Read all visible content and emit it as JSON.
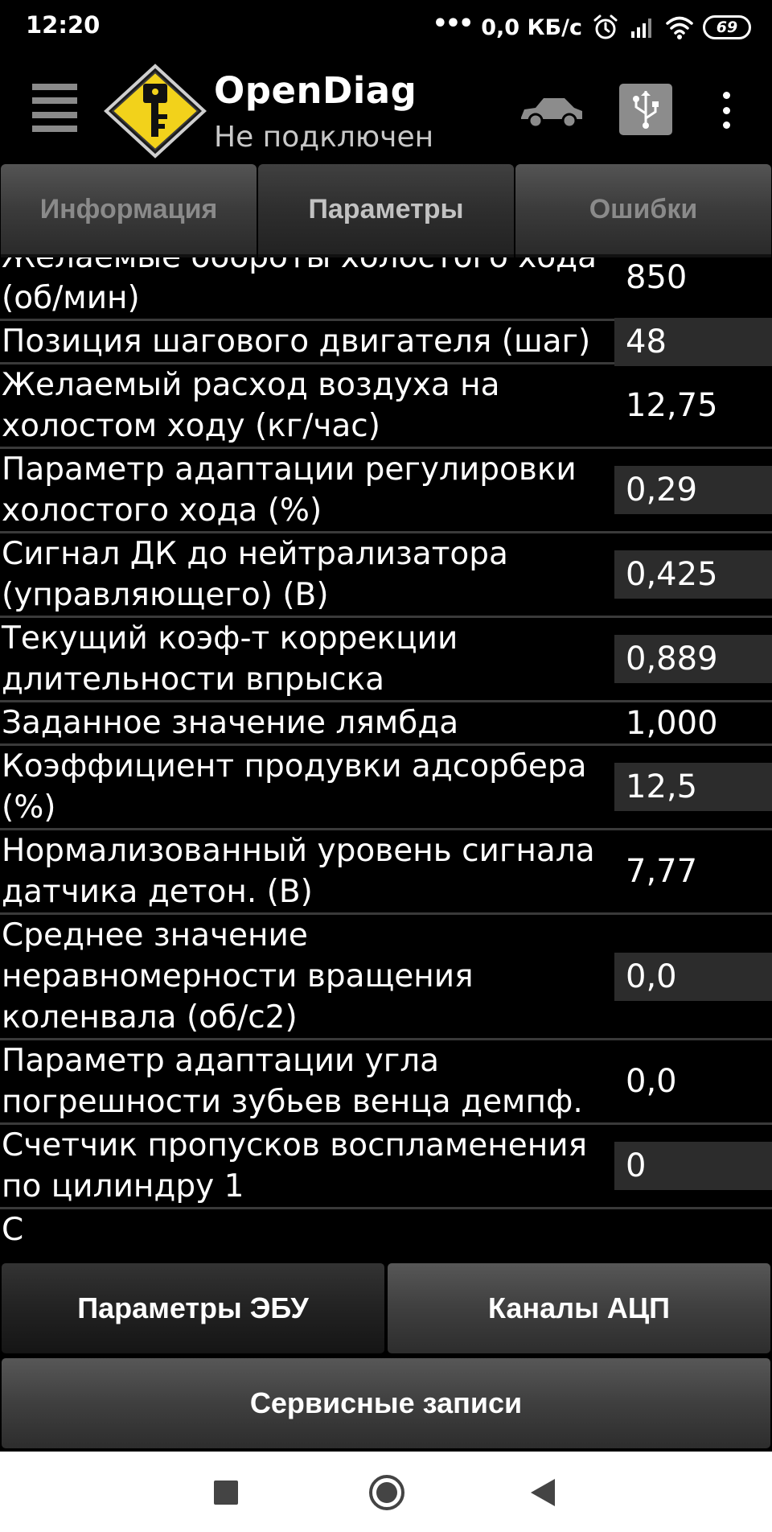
{
  "status_bar": {
    "time": "12:20",
    "dots": "•••",
    "speed": "0,0 КБ/с",
    "battery": "69"
  },
  "toolbar": {
    "title": "OpenDiag",
    "subtitle": "Не подключен",
    "icons": [
      "menu-icon",
      "key-logo-icon",
      "car-icon",
      "usb-icon",
      "more-vert-icon"
    ]
  },
  "tabs": [
    {
      "label": "Информация",
      "active": false
    },
    {
      "label": "Параметры",
      "active": true
    },
    {
      "label": "Ошибки",
      "active": false
    }
  ],
  "parameters": [
    {
      "name": "Желаемые обороты холостого хода (об/мин)",
      "value": "850",
      "shaded": false
    },
    {
      "name": "Позиция шагового двигателя (шаг)",
      "value": "48",
      "shaded": true
    },
    {
      "name": "Желаемый расход воздуха на холостом ходу (кг/час)",
      "value": "12,75",
      "shaded": false
    },
    {
      "name": "Параметр адаптации регулировки холостого хода (%)",
      "value": "0,29",
      "shaded": true
    },
    {
      "name": "Сигнал ДК до нейтрализатора (управляющего) (В)",
      "value": "0,425",
      "shaded": true
    },
    {
      "name": "Текущий коэф-т коррекции длительности впрыска",
      "value": "0,889",
      "shaded": true
    },
    {
      "name": "Заданное значение лямбда",
      "value": "1,000",
      "shaded": false
    },
    {
      "name": "Коэффициент продувки адсорбера (%)",
      "value": "12,5",
      "shaded": true
    },
    {
      "name": "Нормализованный уровень сигнала датчика детон. (В)",
      "value": "7,77",
      "shaded": false
    },
    {
      "name": "Среднее значение неравномерности вращения коленвала (об/с2)",
      "value": "0,0",
      "shaded": true
    },
    {
      "name": "Параметр адаптации угла погрешности зубьев венца демпф.",
      "value": "0,0",
      "shaded": false
    },
    {
      "name": "Счетчик пропусков воспламенения по цилиндру 1",
      "value": "0",
      "shaded": true
    },
    {
      "name": "С",
      "value": "",
      "shaded": false
    }
  ],
  "buttons": {
    "ecu_params": "Параметры ЭБУ",
    "adc_channels": "Каналы АЦП",
    "service_records": "Сервисные записи"
  }
}
